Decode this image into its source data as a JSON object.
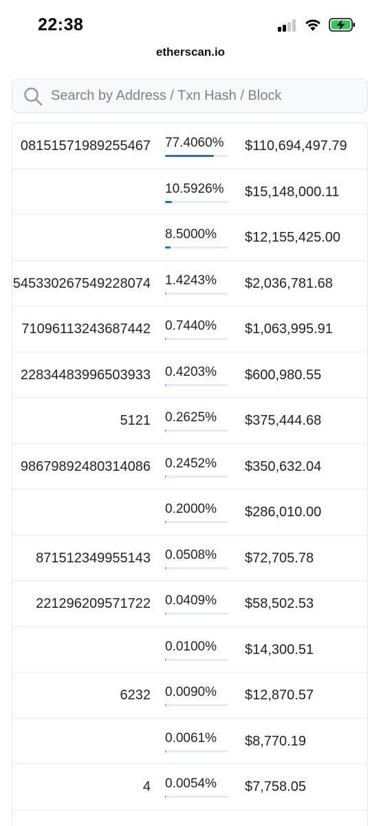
{
  "status_bar": {
    "time": "22:38"
  },
  "browser": {
    "url": "etherscan.io"
  },
  "search": {
    "placeholder": "Search by Address / Txn Hash / Block"
  },
  "holders": [
    {
      "address_fragment": "08151571989255467",
      "percentage": "77.4060%",
      "percent_value": 77.406,
      "value": "$110,694,497.79"
    },
    {
      "address_fragment": "",
      "percentage": "10.5926%",
      "percent_value": 10.5926,
      "value": "$15,148,000.11"
    },
    {
      "address_fragment": "",
      "percentage": "8.5000%",
      "percent_value": 8.5,
      "value": "$12,155,425.00"
    },
    {
      "address_fragment": "545330267549228074",
      "percentage": "1.4243%",
      "percent_value": 1.4243,
      "value": "$2,036,781.68"
    },
    {
      "address_fragment": "71096113243687442",
      "percentage": "0.7440%",
      "percent_value": 0.744,
      "value": "$1,063,995.91"
    },
    {
      "address_fragment": "22834483996503933",
      "percentage": "0.4203%",
      "percent_value": 0.4203,
      "value": "$600,980.55"
    },
    {
      "address_fragment": "5121",
      "percentage": "0.2625%",
      "percent_value": 0.2625,
      "value": "$375,444.68"
    },
    {
      "address_fragment": "98679892480314086",
      "percentage": "0.2452%",
      "percent_value": 0.2452,
      "value": "$350,632.04"
    },
    {
      "address_fragment": "",
      "percentage": "0.2000%",
      "percent_value": 0.2,
      "value": "$286,010.00"
    },
    {
      "address_fragment": "871512349955143",
      "percentage": "0.0508%",
      "percent_value": 0.0508,
      "value": "$72,705.78"
    },
    {
      "address_fragment": "221296209571722",
      "percentage": "0.0409%",
      "percent_value": 0.0409,
      "value": "$58,502.53"
    },
    {
      "address_fragment": "",
      "percentage": "0.0100%",
      "percent_value": 0.01,
      "value": "$14,300.51"
    },
    {
      "address_fragment": "6232",
      "percentage": "0.0090%",
      "percent_value": 0.009,
      "value": "$12,870.57"
    },
    {
      "address_fragment": "",
      "percentage": "0.0061%",
      "percent_value": 0.0061,
      "value": "$8,770.19"
    },
    {
      "address_fragment": "4",
      "percentage": "0.0054%",
      "percent_value": 0.0054,
      "value": "$7,758.05"
    }
  ],
  "colors": {
    "progress_fill": "#1f6fc5",
    "progress_track": "#e7eaf3",
    "battery_charging": "#34c759"
  }
}
